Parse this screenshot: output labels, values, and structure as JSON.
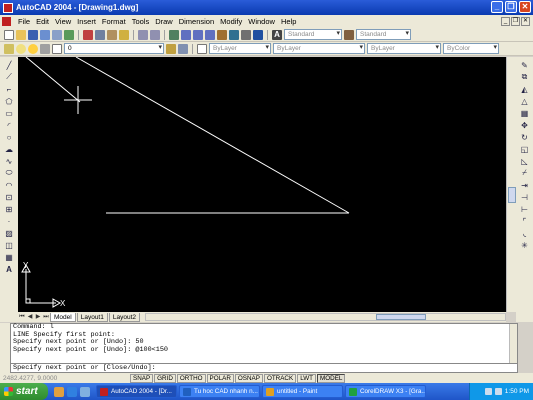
{
  "window": {
    "title": "AutoCAD 2004 - [Drawing1.dwg]",
    "controls": [
      "_",
      "❐",
      "✕"
    ]
  },
  "menu": [
    "File",
    "Edit",
    "View",
    "Insert",
    "Format",
    "Tools",
    "Draw",
    "Dimension",
    "Modify",
    "Window",
    "Help"
  ],
  "toolbar": {
    "text_style": "Standard",
    "dim_style": "Standard",
    "layer": "0",
    "color": "ByLayer",
    "linetype": "ByLayer",
    "lineweight": "ByLayer",
    "plotstyle": "ByColor"
  },
  "layout_tabs": [
    "Model",
    "Layout1",
    "Layout2"
  ],
  "ucs": {
    "x_label": "X",
    "y_label": "Y"
  },
  "command_history": [
    "Command: l",
    "LINE Specify first point:",
    "Specify next point or [Undo]: 50",
    "Specify next point or [Undo]: @100<150"
  ],
  "command_prompt": "Specify next point or [Close/Undo]:",
  "status": {
    "coords": "2482.4277, 9.0000",
    "buttons": [
      {
        "label": "SNAP",
        "on": false
      },
      {
        "label": "GRID",
        "on": false
      },
      {
        "label": "ORTHO",
        "on": false
      },
      {
        "label": "POLAR",
        "on": false
      },
      {
        "label": "OSNAP",
        "on": false
      },
      {
        "label": "OTRACK",
        "on": false
      },
      {
        "label": "LWT",
        "on": false
      },
      {
        "label": "MODEL",
        "on": true
      }
    ]
  },
  "taskbar": {
    "start": "start",
    "tasks": [
      {
        "label": "AutoCAD 2004 - [Dr...",
        "color": "#c02020",
        "active": true
      },
      {
        "label": "Tu hoc CAD nhanh n...",
        "color": "#2060c0",
        "active": false
      },
      {
        "label": "untitled - Paint",
        "color": "#e0a020",
        "active": false
      },
      {
        "label": "CorelDRAW X3 - [Gra...",
        "color": "#20a040",
        "active": false
      }
    ],
    "clock": "1:50 PM"
  },
  "colors": {
    "canvas": "#000000",
    "line": "#ffffff",
    "titlebar": "#0a3ab0",
    "taskbar": "#1f55c8"
  }
}
